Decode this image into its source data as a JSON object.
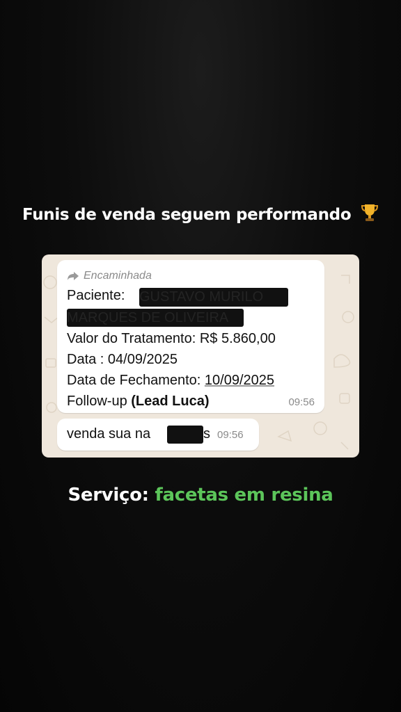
{
  "headline": {
    "text": "Funis de venda seguem performando",
    "icon": "trophy-icon"
  },
  "message": {
    "forwarded_label": "Encaminhada",
    "patient_label": "Paciente:",
    "patient_name_line1": "GUSTAVO MURILO",
    "patient_name_line2": "MARQUES DE OLIVEIRA",
    "treatment_value": "Valor do Tratamento: R$ 5.860,00",
    "date": "Data : 04/09/2025",
    "closing_label": "Data de Fechamento:",
    "closing_date": "10/09/2025",
    "followup_label": "Follow-up",
    "followup_lead": "(Lead Luca)",
    "time": "09:56"
  },
  "reply": {
    "text_before": "venda sua na",
    "text_after": "s",
    "time": "09:56"
  },
  "service": {
    "label": "Serviço:",
    "value": "facetas em resina"
  },
  "colors": {
    "background": "#0a0a0a",
    "chat_bg": "#efe7dc",
    "bubble": "#ffffff",
    "accent_green": "#5cc55a"
  }
}
